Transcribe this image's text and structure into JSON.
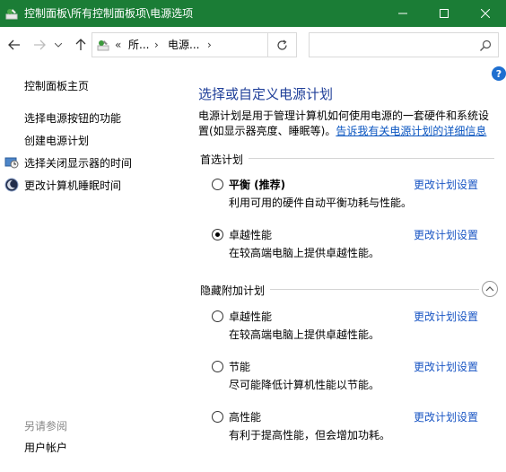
{
  "window": {
    "title": "控制面板\\所有控制面板项\\电源选项",
    "title_bar_color": "#1b7d36"
  },
  "nav": {
    "breadcrumb": [
      "«",
      "所...",
      "›",
      "电源...",
      "›"
    ]
  },
  "search": {
    "placeholder": ""
  },
  "left_pane": {
    "home": "控制面板主页",
    "links": [
      "选择电源按钮的功能",
      "创建电源计划",
      "选择关闭显示器的时间",
      "更改计算机睡眠时间"
    ],
    "see_also_heading": "另请参阅",
    "see_also_links": [
      "用户帐户"
    ]
  },
  "main": {
    "title": "选择或自定义电源计划",
    "description": "电源计划是用于管理计算机如何使用电源的一套硬件和系统设置(如显示器亮度、睡眠等)。",
    "description_link": "告诉我有关电源计划的详细信息",
    "preferred_section": "首选计划",
    "hidden_section": "隐藏附加计划",
    "change_link": "更改计划设置",
    "preferred_plans": [
      {
        "name": "平衡 (推荐)",
        "desc": "利用可用的硬件自动平衡功耗与性能。",
        "selected": false
      },
      {
        "name": "卓越性能",
        "desc": "在较高端电脑上提供卓越性能。",
        "selected": true
      }
    ],
    "hidden_plans": [
      {
        "name": "卓越性能",
        "desc": "在较高端电脑上提供卓越性能。",
        "selected": false
      },
      {
        "name": "节能",
        "desc": "尽可能降低计算机性能以节能。",
        "selected": false
      },
      {
        "name": "高性能",
        "desc": "有利于提高性能，但会增加功耗。",
        "selected": false
      }
    ]
  },
  "colors": {
    "title_text": "#1f3f99",
    "link": "#1a56c4",
    "help": "#1e6fd0"
  }
}
